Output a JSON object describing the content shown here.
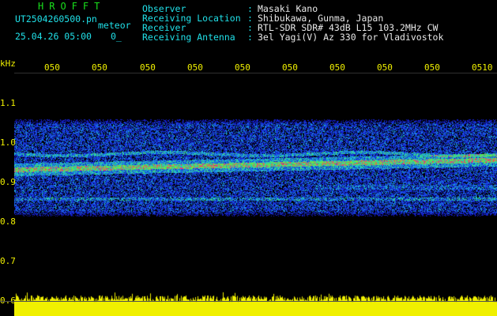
{
  "header": {
    "brand": "HROFFT",
    "filename": "UT2504260500.pn",
    "mode": "meteor",
    "datetime": "25.04.26 05:00",
    "counter": "0_",
    "fields": [
      {
        "label": "Observer",
        "sep": ":",
        "value": "Masaki Kano"
      },
      {
        "label": "Receiving Location",
        "sep": ":",
        "value": "Shibukawa, Gunma, Japan"
      },
      {
        "label": "Receiver",
        "sep": ":",
        "value": "RTL-SDR SDR# 43dB L15 103.2MHz CW"
      },
      {
        "label": "Receiving Antenna",
        "sep": ":",
        "value": "3el Yagi(V) Az 330 for Vladivostok"
      }
    ]
  },
  "axes": {
    "y_unit": "kHz",
    "y_ticks": [
      "1.1",
      "1.0",
      "0.9",
      "0.8",
      "0.7",
      "0.6"
    ],
    "x_ticks": [
      "050",
      "050",
      "050",
      "050",
      "050",
      "050",
      "050",
      "050",
      "050",
      "0510"
    ]
  },
  "spectrogram": {
    "band_top_khz": 1.03,
    "band_bottom_khz": 0.77,
    "main_echo_khz": 0.895,
    "colors": {
      "background": "#000000",
      "low": "#1a2ad8",
      "mid": "#20c8d0",
      "high": "#30e030",
      "peak": "#ff2060",
      "amplitude": "#f0f000"
    }
  }
}
